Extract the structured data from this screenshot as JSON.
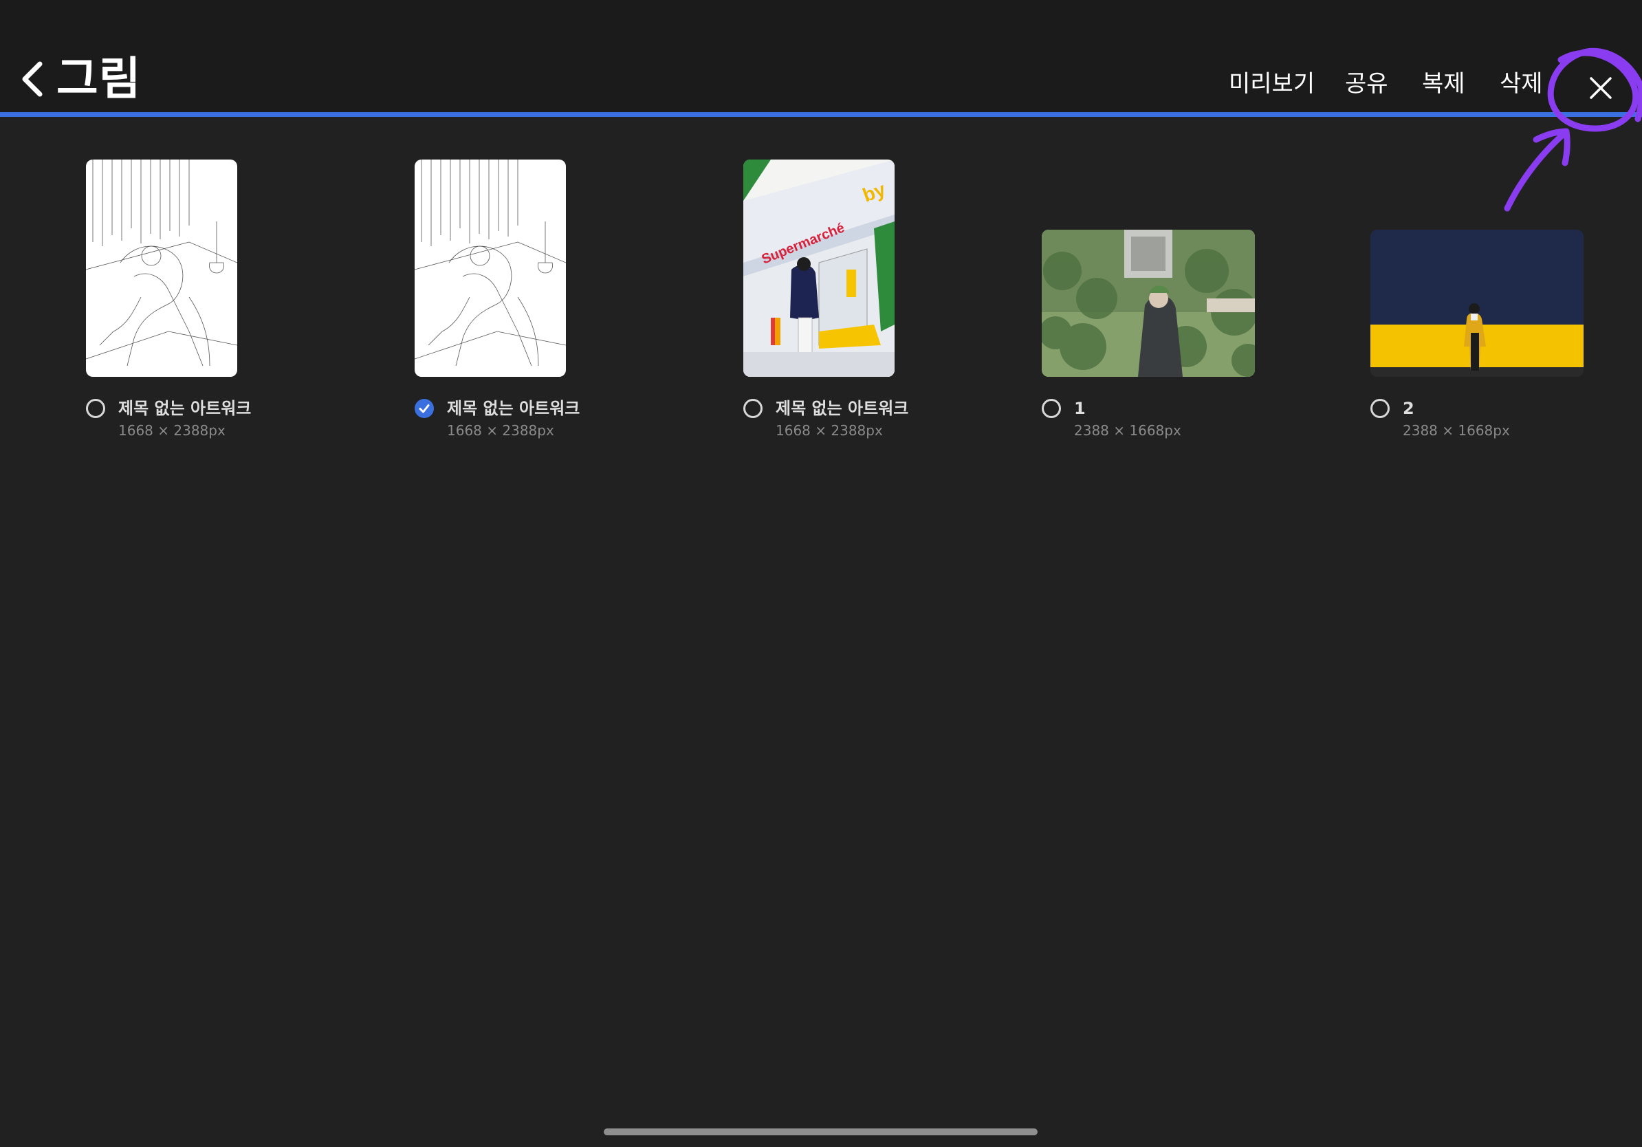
{
  "header": {
    "title": "그림",
    "actions": {
      "preview": "미리보기",
      "share": "공유",
      "duplicate": "복제",
      "delete": "삭제"
    }
  },
  "colors": {
    "accent": "#3a6fe0",
    "checkbox_selected": "#3a6fe0",
    "annotation": "#8a3cf0",
    "background": "#212121"
  },
  "artworks": [
    {
      "title": "제목 없는 아트워크",
      "size": "1668 × 2388px",
      "selected": false,
      "icon": "sketch-thumbnail"
    },
    {
      "title": "제목 없는 아트워크",
      "size": "1668 × 2388px",
      "selected": true,
      "icon": "sketch-thumbnail"
    },
    {
      "title": "제목 없는 아트워크",
      "size": "1668 × 2388px",
      "selected": false,
      "icon": "supermarche-illustration-thumbnail"
    },
    {
      "title": "1",
      "size": "2388 × 1668px",
      "selected": false,
      "icon": "photo-ivy-wall-thumbnail"
    },
    {
      "title": "2",
      "size": "2388 × 1668px",
      "selected": false,
      "icon": "navy-yellow-figure-thumbnail"
    }
  ],
  "thumbnail_text": {
    "supermarche": "Supermarché",
    "by": "by"
  }
}
